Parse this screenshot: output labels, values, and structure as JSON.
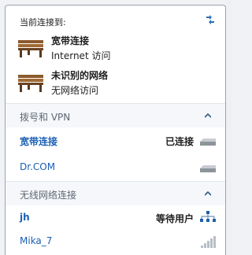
{
  "header": {
    "title": "当前连接到:"
  },
  "current_connections": [
    {
      "name": "宽带连接",
      "status": "Internet 访问"
    },
    {
      "name": "未识别的网络",
      "status": "无网络访问"
    }
  ],
  "dialup_section": {
    "title": "拨号和 VPN",
    "items": [
      {
        "name": "宽带连接",
        "status": "已连接",
        "icon": "modem-icon"
      },
      {
        "name": "Dr.COM",
        "status": "",
        "icon": "modem-icon"
      }
    ]
  },
  "wireless_section": {
    "title": "无线网络连接",
    "items": [
      {
        "name": "jh",
        "status": "等待用户",
        "icon": "network-tree-icon"
      },
      {
        "name": "Mika_7",
        "status": "",
        "icon": "signal-bars-icon"
      }
    ]
  },
  "colors": {
    "link": "#1a5fb4",
    "section_bg": "#f5f7fa"
  }
}
